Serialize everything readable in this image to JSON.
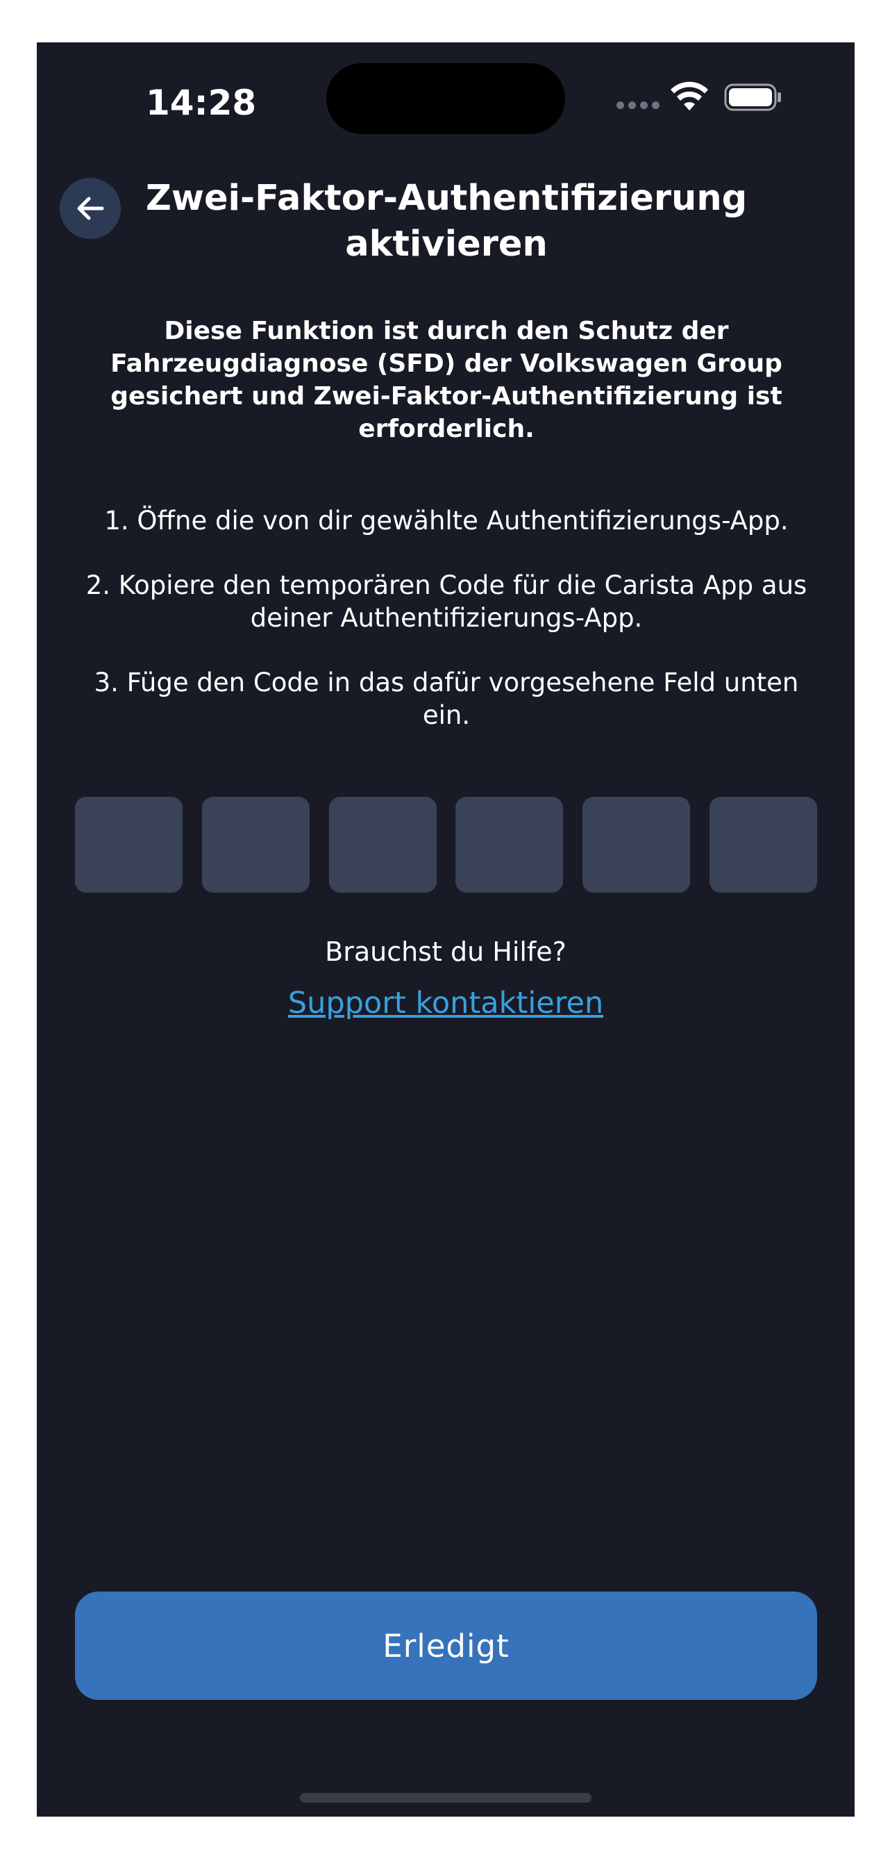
{
  "status_bar": {
    "time": "14:28"
  },
  "header": {
    "back_icon": "arrow-left-icon",
    "title": "Zwei-Faktor-Authentifizierung aktivieren"
  },
  "notice": "Diese Funktion ist durch den Schutz der Fahrzeugdiagnose (SFD) der Volkswagen Group gesichert und Zwei-Faktor-Authentifizierung ist erforderlich.",
  "steps": [
    "1. Öffne die von dir gewählte Authentifizierungs-App.",
    "2. Kopiere den temporären Code für die Carista App aus deiner Authentifizierungs-App.",
    "3. Füge den Code in das dafür vorgesehene Feld unten ein."
  ],
  "code_fields": [
    "",
    "",
    "",
    "",
    "",
    ""
  ],
  "help": {
    "question": "Brauchst du Hilfe?",
    "link": "Support kontaktieren"
  },
  "done_button": "Erledigt",
  "colors": {
    "background": "#181b25",
    "code_box": "#3a4257",
    "accent_button": "#3673ba",
    "link": "#3aa0e0",
    "back_button": "#2c3a56"
  }
}
